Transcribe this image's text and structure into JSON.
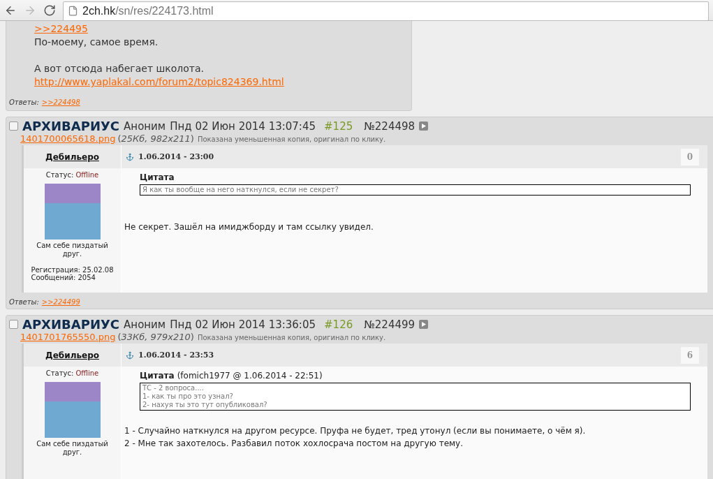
{
  "browser": {
    "host": "2ch.hk",
    "path": "/sn/res/224173.html"
  },
  "first_post": {
    "body": [
      {
        "kind": "link",
        "text": ">>224495"
      },
      {
        "kind": "text",
        "text": "По-моему, самое время."
      },
      {
        "kind": "gap"
      },
      {
        "kind": "text",
        "text": "А вот отсюда набегает школота."
      },
      {
        "kind": "link",
        "text": "http://www.yaplakal.com/forum2/topic824369.html"
      }
    ],
    "replies": {
      "label": "Ответы:",
      "link": ">>224498"
    }
  },
  "posts": [
    {
      "checked": false,
      "subject": "АРХИВАРИУС",
      "name": "Аноним",
      "date": "Пнд 02 Июн 2014 13:07:45",
      "index": "#125",
      "number": "№224498",
      "file": {
        "name": "1401700065618.png",
        "meta": "(*25Кб, 982x211*)",
        "note": "Показана уменьшенная копия, оригинал по клику."
      },
      "shot": {
        "author": "Дебильеро",
        "date": "1.06.2014 - 23:00",
        "counter": "0",
        "status_label": "Статус:",
        "status": "Offline",
        "caption": "Сам себе пиздатый друг.",
        "stats": [
          "Регистрация: 25.02.08",
          "Сообщений: 2054"
        ],
        "quote": {
          "title": "Цитата",
          "lines": [
            "Я как ты вообще на него наткнулся, если не секрет?"
          ]
        },
        "body": [
          "Не секрет. Зашёл на имиджборду и там ссылку увидел."
        ]
      },
      "replies": {
        "label": "Ответы:",
        "link": ">>224499"
      }
    },
    {
      "checked": false,
      "subject": "АРХИВАРИУС",
      "name": "Аноним",
      "date": "Пнд 02 Июн 2014 13:36:05",
      "index": "#126",
      "number": "№224499",
      "file": {
        "name": "1401701765550.png",
        "meta": "(*33Кб, 979x210*)",
        "note": "Показана уменьшенная копия, оригинал по клику."
      },
      "shot": {
        "author": "Дебильеро",
        "date": "1.06.2014 - 23:53",
        "counter": "6",
        "status_label": "Статус:",
        "status": "Offline",
        "caption": "Сам себе пиздатый друг.",
        "quote": {
          "title": "Цитата",
          "source": "(fomich1977 @ 1.06.2014 - 22:51)",
          "lines": [
            "ТС - 2 вопроса....",
            "1- как ты про это узнал?",
            "2- нахуя ты это тут опубликовал?"
          ]
        },
        "body": [
          "1 - Случайно наткнулся на другом ресурсе. Пруфа не будет, тред утонул (если вы понимаете, о чём я).",
          "2 - Мне так захотелось. Разбавил поток хохлосрача постом на другую тему."
        ]
      }
    }
  ]
}
